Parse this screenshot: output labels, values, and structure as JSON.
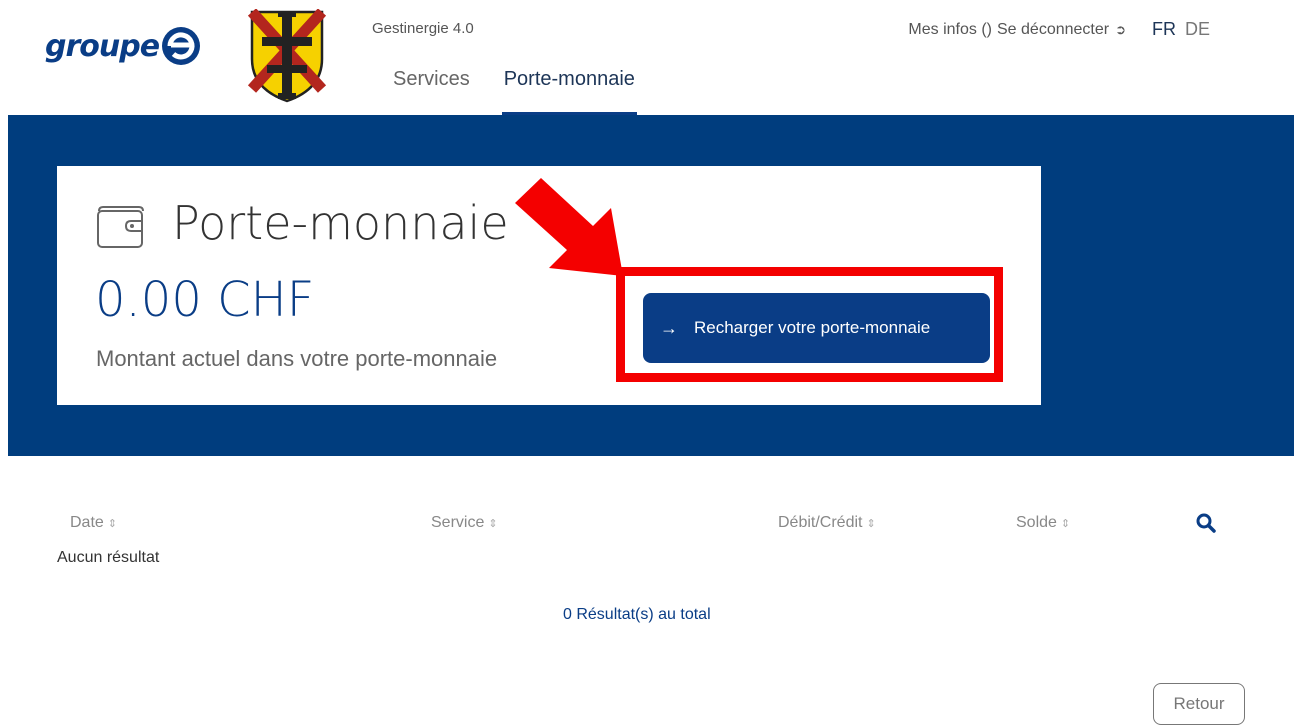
{
  "header": {
    "logo_text": "groupe",
    "app_name": "Gestinergie 4.0",
    "nav": [
      {
        "label": "Services",
        "active": false
      },
      {
        "label": "Porte-monnaie",
        "active": true
      }
    ],
    "my_info": "Mes infos ()",
    "logout": "Se déconnecter",
    "languages": [
      "FR",
      "DE"
    ]
  },
  "wallet": {
    "title": "Porte-monnaie",
    "amount": "0.00 CHF",
    "caption": "Montant actuel dans votre porte-monnaie",
    "recharge_button": "Recharger votre porte-monnaie",
    "icon": "wallet-icon"
  },
  "table": {
    "columns": [
      "Date",
      "Service",
      "Débit/Crédit",
      "Solde"
    ],
    "empty_message": "Aucun résultat",
    "total": "0 Résultat(s) au total"
  },
  "footer": {
    "back_button": "Retour"
  },
  "colors": {
    "brand_blue": "#003d7e",
    "accent_blue": "#0a3d86",
    "highlight_red": "#f40000"
  }
}
